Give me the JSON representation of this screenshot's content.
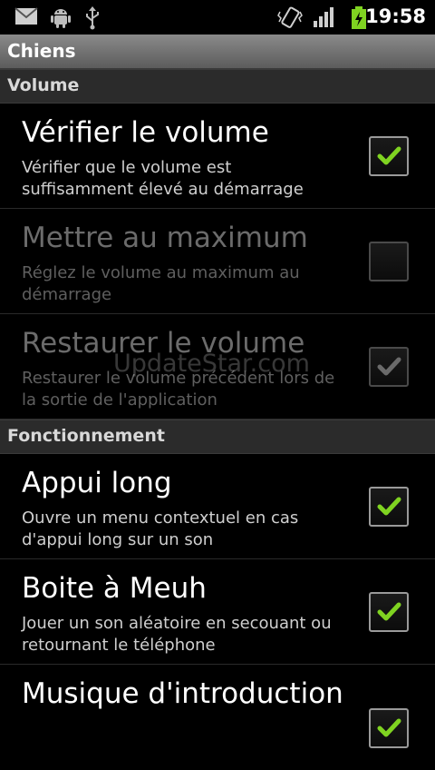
{
  "status_bar": {
    "time": "19:58",
    "icons": [
      "gmail-icon",
      "android-debug-icon",
      "usb-icon",
      "vibrate-icon",
      "signal-icon",
      "battery-charging-icon"
    ]
  },
  "title_bar": {
    "title": "Chiens"
  },
  "categories": {
    "volume": "Volume",
    "fonctionnement": "Fonctionnement"
  },
  "preferences": [
    {
      "title": "Vérifier le volume",
      "summary": "Vérifier que le volume est suffisamment élevé au démarrage",
      "checked": true,
      "enabled": true
    },
    {
      "title": "Mettre au maximum",
      "summary": "Réglez le volume au maximum au démarrage",
      "checked": false,
      "enabled": false
    },
    {
      "title": "Restaurer le volume",
      "summary": "Restaurer le volume précédent lors de la sortie de l'application",
      "checked": true,
      "enabled": false
    },
    {
      "title": "Appui long",
      "summary": "Ouvre un menu contextuel en cas d'appui long sur un son",
      "checked": true,
      "enabled": true
    },
    {
      "title": "Boite à Meuh",
      "summary": "Jouer un son aléatoire en secouant ou retournant le téléphone",
      "checked": true,
      "enabled": true
    },
    {
      "title": "Musique d'introduction",
      "summary": "",
      "checked": true,
      "enabled": true
    }
  ],
  "watermark": "UpdateStar.com",
  "colors": {
    "check_enabled": "#7fd321",
    "check_disabled": "#6a6a6a"
  }
}
